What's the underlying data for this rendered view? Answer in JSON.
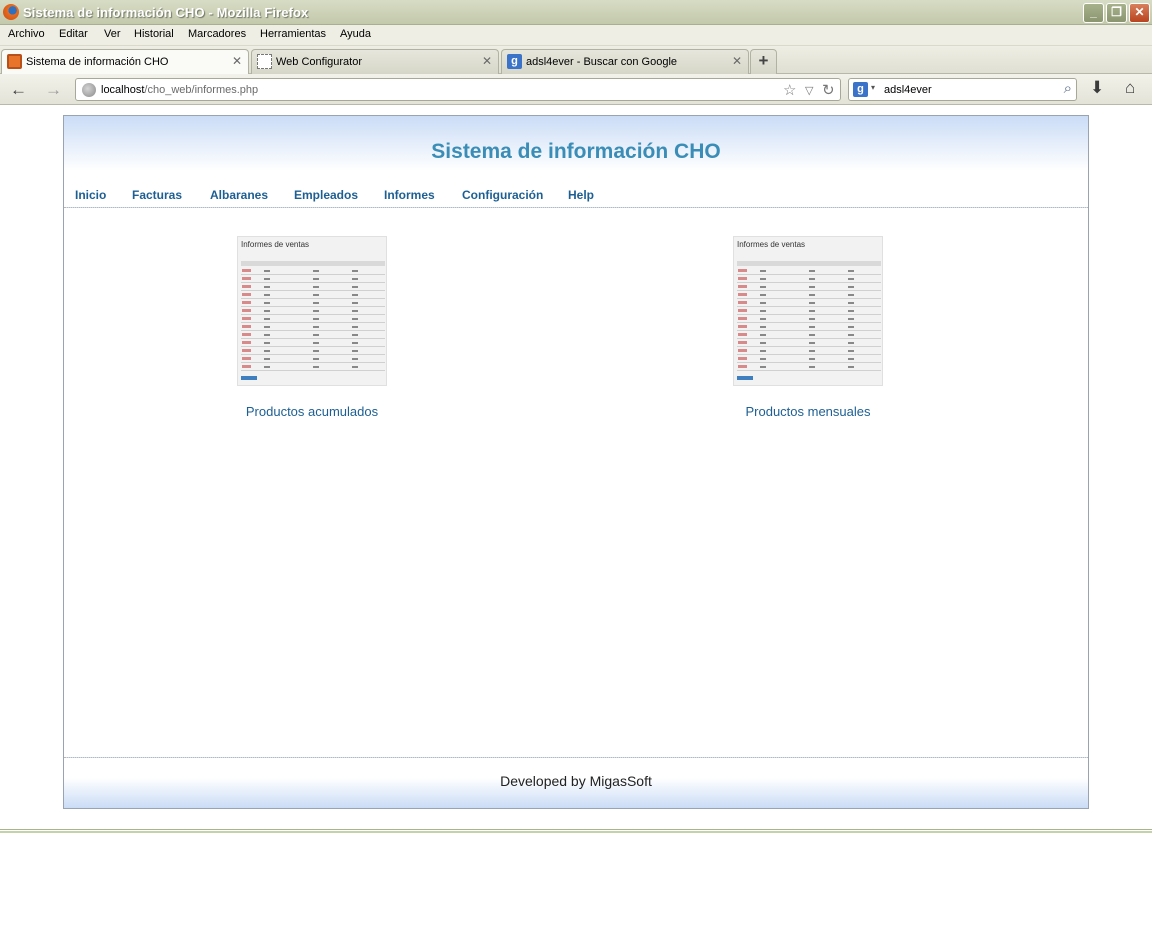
{
  "window": {
    "title": "Sistema de información CHO - Mozilla Firefox",
    "buttons": [
      "_",
      "❐",
      "✕"
    ]
  },
  "menu": [
    "Archivo",
    "Editar",
    "Ver",
    "Historial",
    "Marcadores",
    "Herramientas",
    "Ayuda"
  ],
  "tabs": [
    {
      "label": "Sistema de información CHO",
      "active": true
    },
    {
      "label": "Web Configurator",
      "active": false
    },
    {
      "label": "adsl4ever - Buscar con Google",
      "active": false
    }
  ],
  "newtab_label": "+",
  "navigation": {
    "url_host": "localhost",
    "url_path": "/cho_web/informes.php",
    "search_value": "adsl4ever",
    "search_engine_letter": "g"
  },
  "site": {
    "title": "Sistema de información CHO",
    "nav": [
      "Inicio",
      "Facturas",
      "Albaranes",
      "Empleados",
      "Informes",
      "Configuración",
      "Help"
    ],
    "reports": [
      {
        "label": "Productos acumulados",
        "thumb_title": "Informes de ventas"
      },
      {
        "label": "Productos mensuales",
        "thumb_title": "Informes de ventas"
      }
    ],
    "footer": "Developed by MigasSoft"
  },
  "colors": {
    "title": "#3a8db6",
    "link": "#1d5f93",
    "header_gradient": "#cadcf6"
  }
}
